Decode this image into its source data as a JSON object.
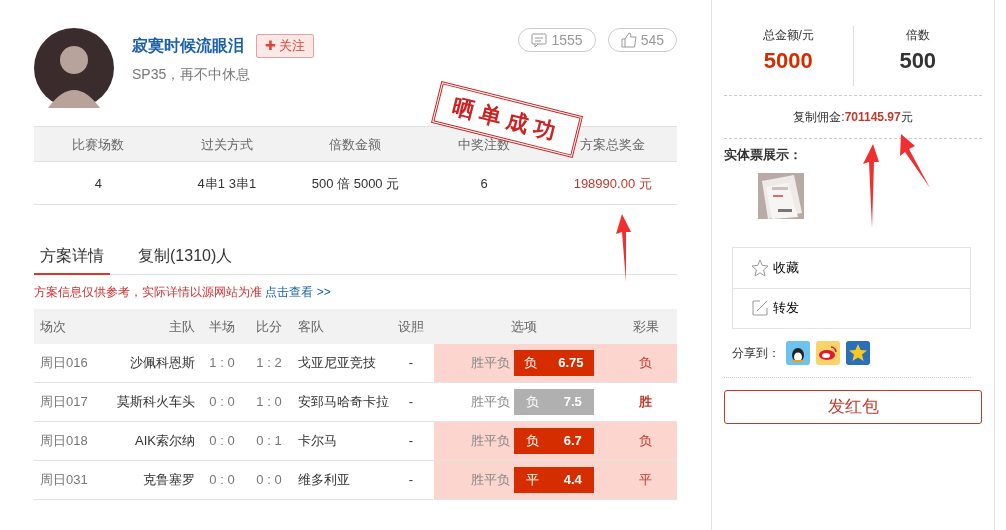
{
  "user": {
    "name": "寂寞时候流眼泪",
    "follow_label": "关注",
    "follow_icon": "✚",
    "motto": "SP35，再不中休息",
    "comments": "1555",
    "likes": "545"
  },
  "stamp": "晒单成功",
  "summary": {
    "columns": [
      "比赛场数",
      "过关方式",
      "倍数金额",
      "中奖注数",
      "方案总奖金"
    ],
    "values": [
      "4",
      "4串1 3串1",
      "500 倍  5000 元",
      "6",
      "198990.00 元"
    ]
  },
  "tabs": [
    {
      "label": "方案详情",
      "selected": true
    },
    {
      "label": "复制(1310)人",
      "selected": false
    }
  ],
  "notice": {
    "text": "方案信息仅供参考，实际详情以源网站为准",
    "link": "点击查看 >>"
  },
  "matches": {
    "columns": [
      "场次",
      "主队",
      "半场",
      "比分",
      "客队",
      "设胆",
      "选项",
      "彩果"
    ],
    "rows": [
      {
        "id": "周日016",
        "home": "沙佩科恩斯",
        "half": "1 : 0",
        "score": "1 : 2",
        "away": "戈亚尼亚竞技",
        "banker": "-",
        "play": "胜平负",
        "pick": "负",
        "odds": "6.75",
        "result": "负",
        "hit": true
      },
      {
        "id": "周日017",
        "home": "莫斯科火车头",
        "half": "0 : 0",
        "score": "1 : 0",
        "away": "安郅马哈奇卡拉",
        "banker": "-",
        "play": "胜平负",
        "pick": "负",
        "odds": "7.5",
        "result": "胜",
        "hit": false
      },
      {
        "id": "周日018",
        "home": "AIK索尔纳",
        "half": "0 : 0",
        "score": "0 : 1",
        "away": "卡尔马",
        "banker": "-",
        "play": "胜平负",
        "pick": "负",
        "odds": "6.7",
        "result": "负",
        "hit": true
      },
      {
        "id": "周日031",
        "home": "克鲁塞罗",
        "half": "0 : 0",
        "score": "0 : 0",
        "away": "维多利亚",
        "banker": "-",
        "play": "胜平负",
        "pick": "平",
        "odds": "4.4",
        "result": "平",
        "hit": true
      }
    ]
  },
  "sidebar": {
    "stats": [
      {
        "label": "总金额/元",
        "value": "5000",
        "kind": "accent"
      },
      {
        "label": "倍数",
        "value": "500",
        "kind": "plain"
      }
    ],
    "commission": {
      "label": "复制佣金:",
      "value": "701145.97",
      "unit": "元"
    },
    "ticket_label": "实体票展示：",
    "actions": [
      {
        "label": "收藏",
        "kind": "star"
      },
      {
        "label": "转发",
        "kind": "edit"
      }
    ],
    "share_label": "分享到：",
    "share": [
      {
        "kind": "qq"
      },
      {
        "kind": "weibo"
      },
      {
        "kind": "qzone"
      }
    ],
    "red_packet": "发红包"
  }
}
